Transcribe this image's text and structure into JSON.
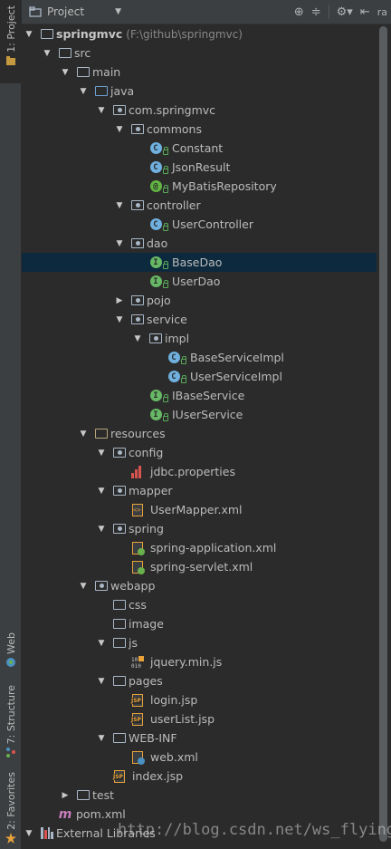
{
  "header": {
    "project_label": "Project",
    "right_label": "ra"
  },
  "leftbar": {
    "project_tab": "1: Project",
    "web_tab": "Web",
    "structure_tab": "7: Structure",
    "favorites_tab": "2: Favorites"
  },
  "tree": {
    "root": {
      "label": "springmvc",
      "path": "(F:\\github\\springmvc)"
    },
    "src": "src",
    "main": "main",
    "java": "java",
    "com_springmvc": "com.springmvc",
    "commons": "commons",
    "constant": "Constant",
    "jsonresult": "JsonResult",
    "mybatisrepo": "MyBatisRepository",
    "controller": "controller",
    "usercontroller": "UserController",
    "dao": "dao",
    "basedao": "BaseDao",
    "userdao": "UserDao",
    "pojo": "pojo",
    "service": "service",
    "impl": "impl",
    "baseserviceimpl": "BaseServiceImpl",
    "userserviceimpl": "UserServiceImpl",
    "ibaseservice": "IBaseService",
    "iuserservice": "IUserService",
    "resources": "resources",
    "config": "config",
    "jdbcprops": "jdbc.properties",
    "mapper": "mapper",
    "usermapper": "UserMapper.xml",
    "spring": "spring",
    "springapp": "spring-application.xml",
    "springservlet": "spring-servlet.xml",
    "webapp": "webapp",
    "css": "css",
    "image": "image",
    "js": "js",
    "jquery": "jquery.min.js",
    "pages": "pages",
    "login": "login.jsp",
    "userlist": "userList.jsp",
    "webinf": "WEB-INF",
    "webxml": "web.xml",
    "index": "index.jsp",
    "test": "test",
    "pom": "pom.xml",
    "extlibs": "External Libraries"
  },
  "badges": {
    "class": "C",
    "interface": "I",
    "annotation": "@",
    "abstract": "C"
  },
  "watermark": "http://blog.csdn.net/ws_flying",
  "colors": {
    "background": "#2b2b2b",
    "panel": "#3c3f41",
    "selection": "#0d293e"
  }
}
